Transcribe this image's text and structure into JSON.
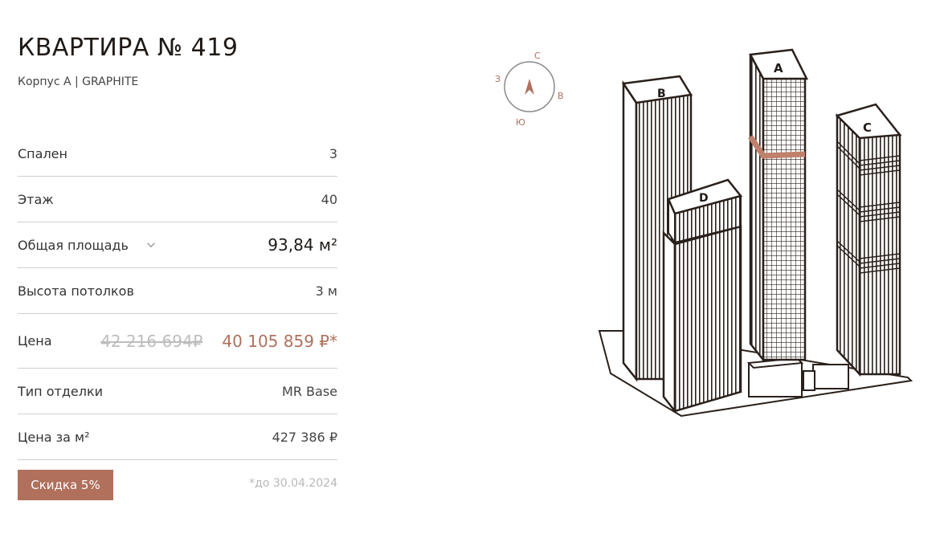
{
  "header": {
    "title": "КВАРТИРА № 419",
    "subtitle": "Корпус A | GRAPHITE"
  },
  "specs": {
    "bedrooms_label": "Спален",
    "bedrooms_value": "3",
    "floor_label": "Этаж",
    "floor_value": "40",
    "area_label": "Общая площадь",
    "area_value": "93,84 м²",
    "ceiling_label": "Высота потолков",
    "ceiling_value": "3 м",
    "price_label": "Цена",
    "old_price": "42 216 694₽",
    "new_price": "40 105 859 ₽*",
    "finish_label": "Тип отделки",
    "finish_value": "MR Base",
    "ppm_label": "Цена за м²",
    "ppm_value": "427 386 ₽"
  },
  "promo": {
    "discount_label": "Скидка 5%",
    "until_text": "*до 30.04.2024"
  },
  "compass": {
    "north": "С",
    "east": "В",
    "south": "Ю",
    "west": "З"
  },
  "towers": {
    "a": "A",
    "b": "B",
    "c": "C",
    "d": "D"
  },
  "colors": {
    "accent": "#b0705c",
    "text": "#1f1a17",
    "muted": "#bdbdbd",
    "divider": "#cfcfcf"
  }
}
